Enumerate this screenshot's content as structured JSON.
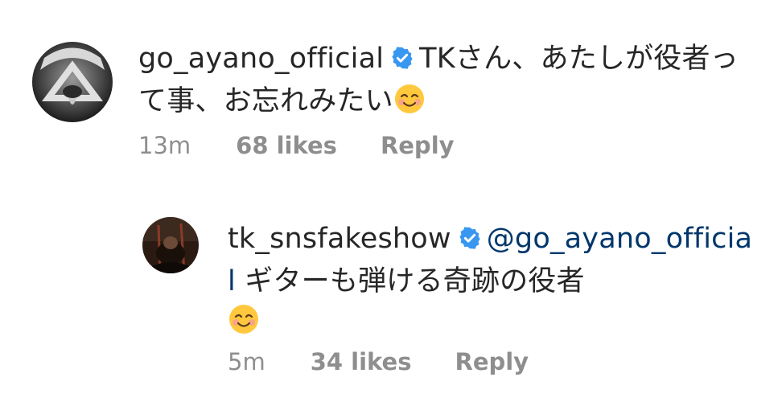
{
  "comments": [
    {
      "username": "go_ayano_official",
      "verified": true,
      "text": "TKさん、あたしが役者って事、お忘れみたい",
      "emoji": "smiling-face-with-smiling-eyes",
      "time": "13m",
      "likes": "68 likes",
      "reply": "Reply"
    },
    {
      "username": "tk_snsfakeshow",
      "verified": true,
      "mention": "@go_ayano_official",
      "text": " ギターも弾ける奇跡の役者",
      "emoji": "smiling-face-with-smiling-eyes",
      "time": "5m",
      "likes": "34 likes",
      "reply": "Reply"
    }
  ],
  "colors": {
    "verified_badge": "#3897f0",
    "mention": "#00376b",
    "meta_text": "#8e8e8e",
    "primary_text": "#262626"
  }
}
